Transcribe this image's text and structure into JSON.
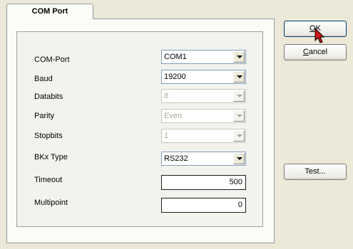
{
  "tab": {
    "label": "COM Port"
  },
  "fields": {
    "com_port": {
      "label": "COM-Port",
      "value": "COM1",
      "enabled": true
    },
    "baud": {
      "label": "Baud",
      "value": "19200",
      "enabled": true
    },
    "databits": {
      "label": "Databits",
      "value": "8",
      "enabled": false
    },
    "parity": {
      "label": "Parity",
      "value": "Even",
      "enabled": false
    },
    "stopbits": {
      "label": "Stopbits",
      "value": "1",
      "enabled": false
    },
    "bkx_type": {
      "label": "BKx Type",
      "value": "RS232",
      "enabled": true
    },
    "timeout": {
      "label": "Timeout",
      "value": "500"
    },
    "multipoint": {
      "label": "Multipoint",
      "value": "0"
    }
  },
  "buttons": {
    "ok": {
      "mnemonic": "O",
      "rest": "K"
    },
    "cancel": {
      "mnemonic": "C",
      "rest": "ancel"
    },
    "test": {
      "label": "Test..."
    }
  },
  "colors": {
    "face": "#ece9d8",
    "panel": "#fbfbf7",
    "focus_border": "#003c74"
  }
}
